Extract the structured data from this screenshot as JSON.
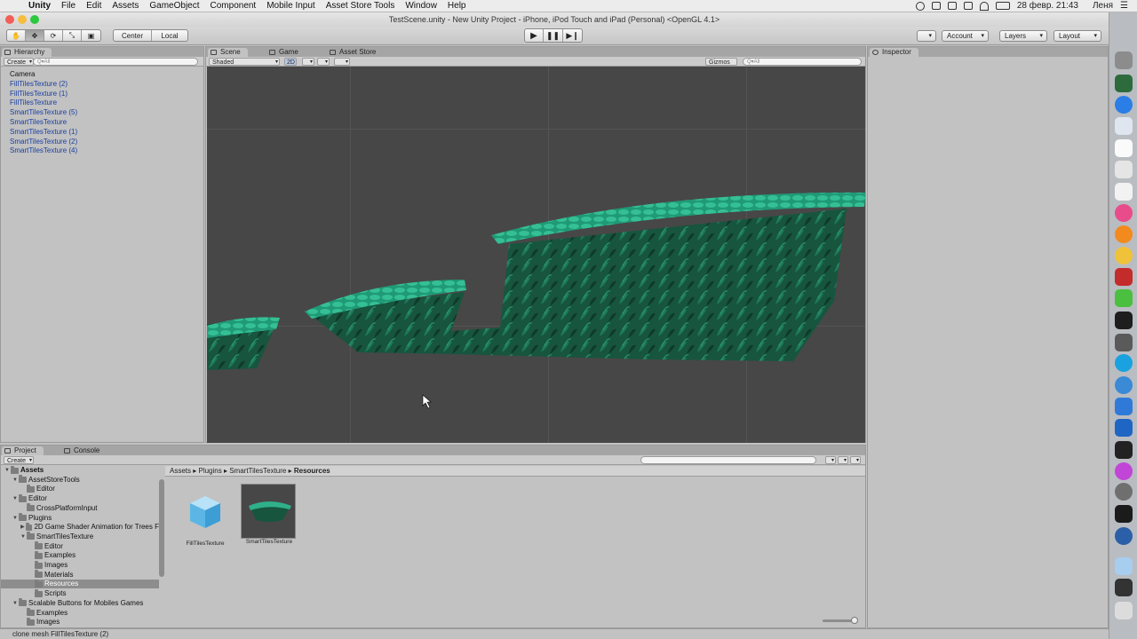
{
  "menubar": {
    "app": "Unity",
    "items": [
      "File",
      "Edit",
      "Assets",
      "GameObject",
      "Component",
      "Mobile Input",
      "Asset Store Tools",
      "Window",
      "Help"
    ],
    "datetime": "28 февр.  21:43",
    "user": "Леня"
  },
  "window": {
    "title": "TestScene.unity - New Unity Project - iPhone, iPod Touch and iPad (Personal) <OpenGL 4.1>"
  },
  "toolbar": {
    "pivot": "Center",
    "space": "Local",
    "account": "Account",
    "layers": "Layers",
    "layout": "Layout"
  },
  "hierarchy": {
    "tab": "Hierarchy",
    "create": "Create",
    "search_placeholder": "Q▾All",
    "items": [
      {
        "name": "Camera",
        "prefab": false
      },
      {
        "name": "FillTilesTexture (2)",
        "prefab": true
      },
      {
        "name": "FillTilesTexture (1)",
        "prefab": true
      },
      {
        "name": "FillTilesTexture",
        "prefab": true
      },
      {
        "name": "SmartTilesTexture (5)",
        "prefab": true
      },
      {
        "name": "SmartTilesTexture",
        "prefab": true
      },
      {
        "name": "SmartTilesTexture (1)",
        "prefab": true
      },
      {
        "name": "SmartTilesTexture (2)",
        "prefab": true
      },
      {
        "name": "SmartTilesTexture (4)",
        "prefab": true
      }
    ]
  },
  "scene": {
    "tabs": [
      "Scene",
      "Game",
      "Asset Store"
    ],
    "shading": "Shaded",
    "mode_2d": "2D",
    "gizmos": "Gizmos",
    "search_placeholder": "Q▾All"
  },
  "inspector": {
    "tab": "Inspector"
  },
  "project": {
    "tabs": [
      "Project",
      "Console"
    ],
    "create": "Create",
    "breadcrumb": [
      "Assets",
      "Plugins",
      "SmartTilesTexture",
      "Resources"
    ],
    "tree": [
      {
        "label": "Assets",
        "depth": 0,
        "expanded": true,
        "bold": true
      },
      {
        "label": "AssetStoreTools",
        "depth": 1,
        "expanded": true
      },
      {
        "label": "Editor",
        "depth": 2
      },
      {
        "label": "Editor",
        "depth": 1,
        "expanded": true
      },
      {
        "label": "CrossPlatformInput",
        "depth": 2
      },
      {
        "label": "Plugins",
        "depth": 1,
        "expanded": true
      },
      {
        "label": "2D Game Shader Animation for Trees F",
        "depth": 2,
        "collapsed": true
      },
      {
        "label": "SmartTilesTexture",
        "depth": 2,
        "expanded": true
      },
      {
        "label": "Editor",
        "depth": 3
      },
      {
        "label": "Examples",
        "depth": 3
      },
      {
        "label": "Images",
        "depth": 3
      },
      {
        "label": "Materials",
        "depth": 3
      },
      {
        "label": "Resources",
        "depth": 3,
        "selected": true
      },
      {
        "label": "Scripts",
        "depth": 3
      },
      {
        "label": "Scalable Buttons for Mobiles Games",
        "depth": 1,
        "expanded": true
      },
      {
        "label": "Examples",
        "depth": 2
      },
      {
        "label": "Images",
        "depth": 2
      }
    ],
    "assets": [
      {
        "label": "FillTilesTexture",
        "kind": "prefab-cube"
      },
      {
        "label": "SmartTilesTexture",
        "kind": "mesh-preview"
      }
    ]
  },
  "status": {
    "message": "clone mesh FillTilesTexture (2)"
  },
  "colors": {
    "prefab_text": "#1a3fa0",
    "terrain_top": "#2fb08a",
    "terrain_body": "#17553f",
    "scene_bg": "#474747"
  }
}
